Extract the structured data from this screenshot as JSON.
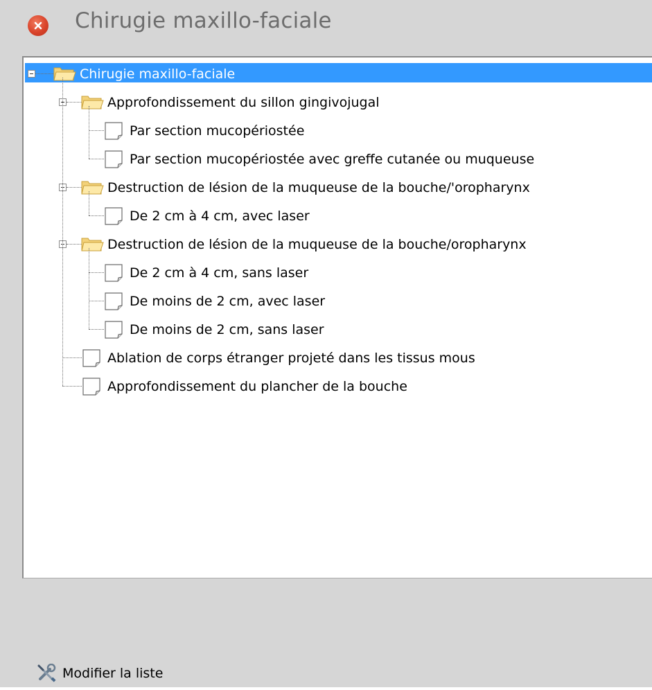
{
  "window": {
    "title": "Chirugie maxillo-faciale",
    "close_icon": "close-icon"
  },
  "tree": {
    "root": {
      "label": "Chirugie maxillo-faciale",
      "expanded": true,
      "selected": true,
      "icon": "folder-open-icon"
    },
    "groups": [
      {
        "label": "Approfondissement du sillon gingivojugal",
        "icon": "folder-open-icon",
        "expanded": true,
        "children": [
          "Par section mucopériostée",
          "Par section mucopériostée avec greffe cutanée ou muqueuse"
        ]
      },
      {
        "label": "Destruction de lésion de la muqueuse de la bouche/'oropharynx",
        "icon": "folder-open-icon",
        "expanded": true,
        "children": [
          "De 2 cm à 4 cm, avec laser"
        ]
      },
      {
        "label": "Destruction de lésion de la muqueuse de la bouche/oropharynx",
        "icon": "folder-open-icon",
        "expanded": true,
        "children": [
          "De 2 cm à 4 cm, sans laser",
          "De moins de 2 cm, avec laser",
          "De moins de 2 cm, sans laser"
        ]
      }
    ],
    "leaves": [
      "Ablation de corps étranger projeté dans les tissus mous",
      "Approfondissement du plancher de la bouche"
    ],
    "document_icon": "document-icon"
  },
  "footer": {
    "modify_label": "Modifier la liste",
    "icon": "tools-icon"
  },
  "colors": {
    "selection": "#3399ff",
    "background": "#d6d6d6",
    "panel": "#ffffff",
    "title": "#6d6d6d",
    "close": "#d9432a"
  }
}
